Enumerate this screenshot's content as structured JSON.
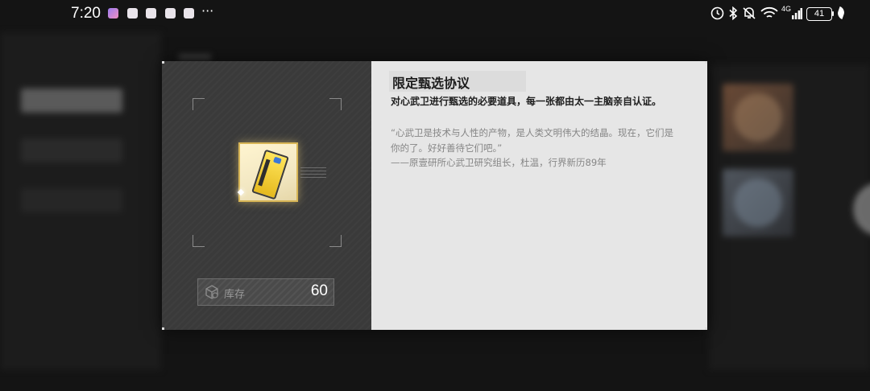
{
  "status_bar": {
    "time": "7:20",
    "more_symbol": "···",
    "network_label": "4G",
    "battery_level": "41",
    "icons": [
      "notification-app-icon",
      "alarm-icon",
      "bluetooth-icon",
      "mute-icon",
      "wifi-icon",
      "signal-icon",
      "battery-icon",
      "leaf-icon"
    ]
  },
  "item_detail": {
    "name": "限定甄选协议",
    "description": "对心武卫进行甄选的必要道具，每一张都由太一主脑亲自认证。",
    "lore": [
      "“心武卫是技术与人性的产物，是人类文明伟大的结晶。现在，它们是",
      "你的了。好好善待它们吧。”",
      "——原壹研所心武卫研究组长，杜温，行界新历89年"
    ],
    "stock_label": "库存",
    "stock_count": "60",
    "icon": "yellow-card-item-icon"
  },
  "colors": {
    "rarity_gold": "#d8b656",
    "card_yellow": "#ffe55a",
    "panel_dark": "#3a3a3a",
    "panel_light": "#e6e6e6"
  }
}
